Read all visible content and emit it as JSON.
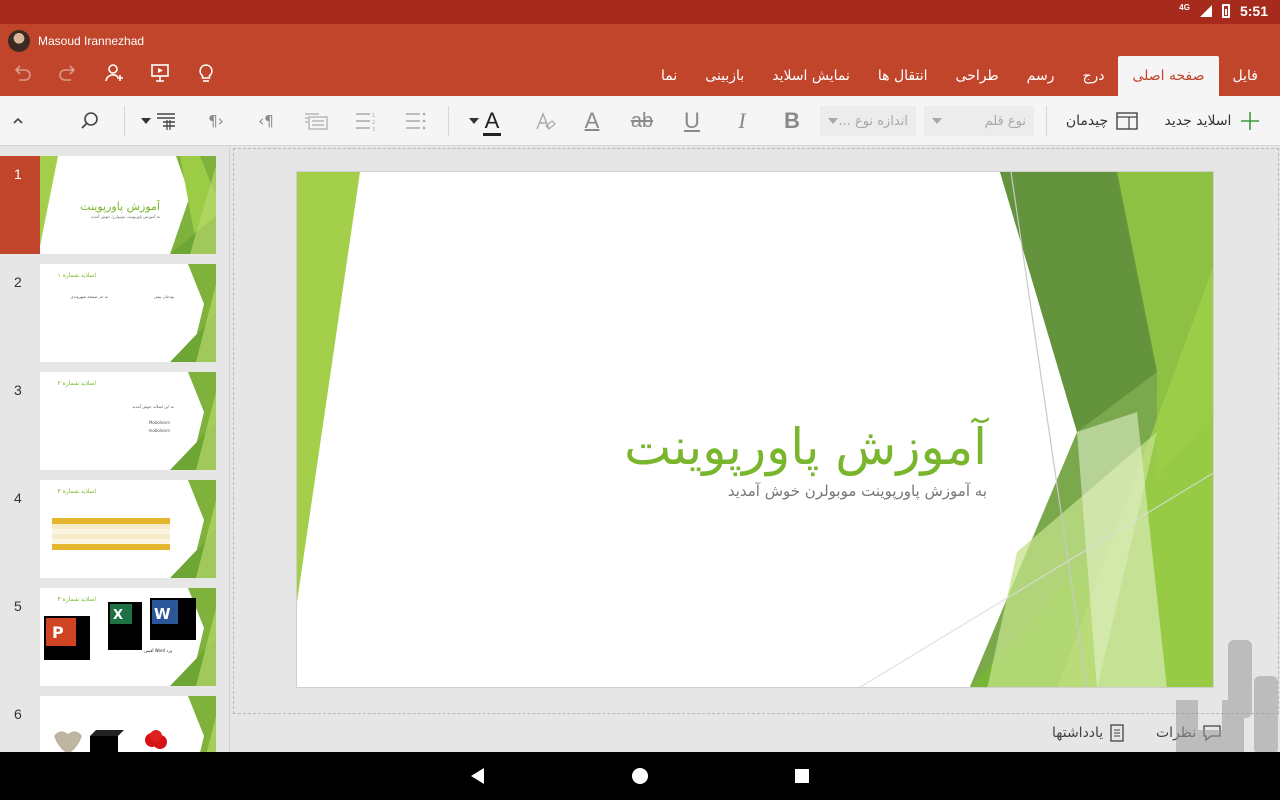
{
  "status_bar": {
    "network": "4G",
    "time": "5:51"
  },
  "user": {
    "name": "Masoud Irannezhad"
  },
  "quick_access": [
    "undo-icon",
    "redo-icon",
    "share-icon",
    "present-icon",
    "idea-icon"
  ],
  "ribbon": {
    "tabs": [
      {
        "label": "فایل",
        "active": false
      },
      {
        "label": "صفحه اصلی",
        "active": true
      },
      {
        "label": "درج",
        "active": false
      },
      {
        "label": "رسم",
        "active": false
      },
      {
        "label": "طراحی",
        "active": false
      },
      {
        "label": "انتقال ها",
        "active": false
      },
      {
        "label": "نمایش اسلاید",
        "active": false
      },
      {
        "label": "بازبینی",
        "active": false
      },
      {
        "label": "نما",
        "active": false
      }
    ]
  },
  "toolbar": {
    "new_slide_label": "اسلاید جدید",
    "layout_label": "چیدمان",
    "font_name_placeholder": "نوع قلم",
    "font_size_placeholder": "اندازه نوع ...",
    "bold": "B",
    "italic": "I",
    "underline": "U",
    "strike": "ab",
    "font_color": "A",
    "font_color_accent": "#222222"
  },
  "slides": [
    {
      "number": "1",
      "title": "آموزش پاورپوینت",
      "subtitle": "به آموزش پاورپوینت موبولرن خوش آمدید",
      "selected": true
    },
    {
      "number": "2",
      "title": "اسلاید شماره ۱",
      "bullets": [
        "پودمان پیش",
        "به جز صفحه شهروندی"
      ]
    },
    {
      "number": "3",
      "title": "اسلاید شماره ۲",
      "bullets": [
        "به این اسلاید خوش آمدید",
        "Mobolearn",
        "mobolearn"
      ]
    },
    {
      "number": "4",
      "title": "اسلاید شماره ۳"
    },
    {
      "number": "5",
      "title": "اسلاید شماره ۴",
      "caption": "ورد Word آفیس"
    },
    {
      "number": "6"
    }
  ],
  "main_slide": {
    "title": "آموزش پاورپوینت",
    "subtitle": "به آموزش پاورپوینت موبولرن خوش آمدید"
  },
  "bottom_bar": {
    "notes_label": "یادداشتها",
    "comments_label": "نظرات"
  },
  "colors": {
    "brand": "#c0452b",
    "status_bar": "#a62b1c",
    "accent_green": "#7ab52e"
  }
}
